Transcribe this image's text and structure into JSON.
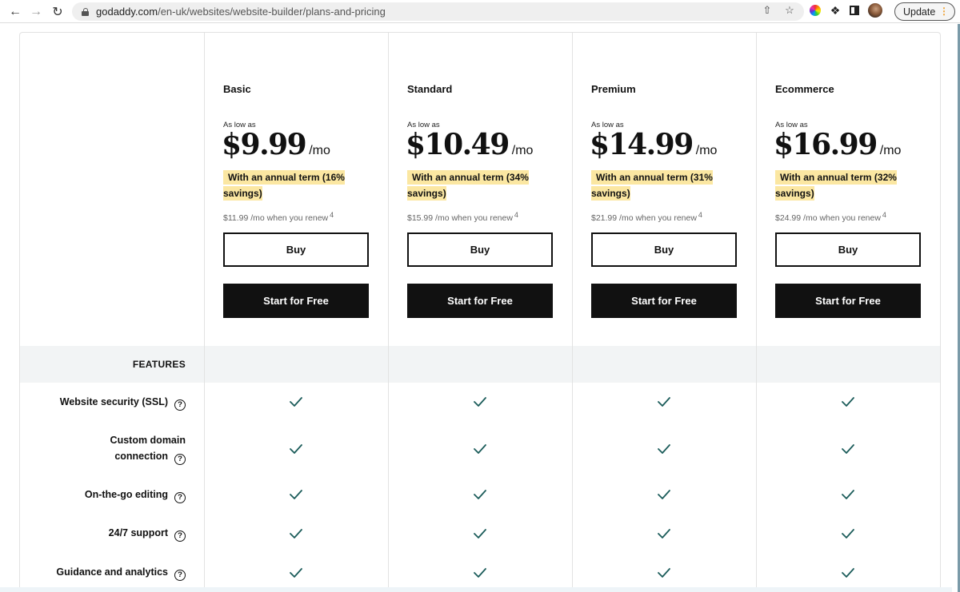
{
  "browser": {
    "url_host": "godaddy.com",
    "url_path": "/en-uk/websites/website-builder/plans-and-pricing",
    "update_label": "Update",
    "icons": [
      "back-arrow-icon",
      "forward-arrow-icon",
      "reload-icon",
      "lock-icon",
      "share-icon",
      "bookmark-star-icon",
      "color-extension-icon",
      "puzzle-extensions-icon",
      "side-panel-icon",
      "profile-avatar",
      "kebab-menu-icon"
    ]
  },
  "plans": [
    {
      "name": "Basic",
      "as_low_as": "As low as",
      "price": "$9.99",
      "per": "/mo",
      "savings_line1": "With an annual term (16%",
      "savings_line2": "savings)",
      "renew": "$11.99 /mo when you renew",
      "footnote": "4",
      "buy_label": "Buy",
      "start_label": "Start for Free"
    },
    {
      "name": "Standard",
      "as_low_as": "As low as",
      "price": "$10.49",
      "per": "/mo",
      "savings_line1": "With an annual term (34%",
      "savings_line2": "savings)",
      "renew": "$15.99 /mo when you renew",
      "footnote": "4",
      "buy_label": "Buy",
      "start_label": "Start for Free"
    },
    {
      "name": "Premium",
      "as_low_as": "As low as",
      "price": "$14.99",
      "per": "/mo",
      "savings_line1": "With an annual term (31%",
      "savings_line2": "savings)",
      "renew": "$21.99 /mo when you renew",
      "footnote": "4",
      "buy_label": "Buy",
      "start_label": "Start for Free"
    },
    {
      "name": "Ecommerce",
      "as_low_as": "As low as",
      "price": "$16.99",
      "per": "/mo",
      "savings_line1": "With an annual term (32%",
      "savings_line2": "savings)",
      "renew": "$24.99 /mo when you renew",
      "footnote": "4",
      "buy_label": "Buy",
      "start_label": "Start for Free"
    }
  ],
  "features": {
    "title": "FEATURES",
    "rows": [
      {
        "label_line1": "Website security (SSL)",
        "label_line2": "",
        "included": [
          true,
          true,
          true,
          true
        ]
      },
      {
        "label_line1": "Custom domain",
        "label_line2": "connection",
        "included": [
          true,
          true,
          true,
          true
        ]
      },
      {
        "label_line1": "On-the-go editing",
        "label_line2": "",
        "included": [
          true,
          true,
          true,
          true
        ]
      },
      {
        "label_line1": "24/7 support",
        "label_line2": "",
        "included": [
          true,
          true,
          true,
          true
        ]
      },
      {
        "label_line1": "Guidance and analytics",
        "label_line2": "",
        "included": [
          true,
          true,
          true,
          true
        ]
      }
    ],
    "help_glyph": "?"
  },
  "colors": {
    "check": "#1b5c5a",
    "savings_highlight": "#fbe7a2",
    "features_band": "#f2f4f5",
    "primary_button": "#111111"
  }
}
